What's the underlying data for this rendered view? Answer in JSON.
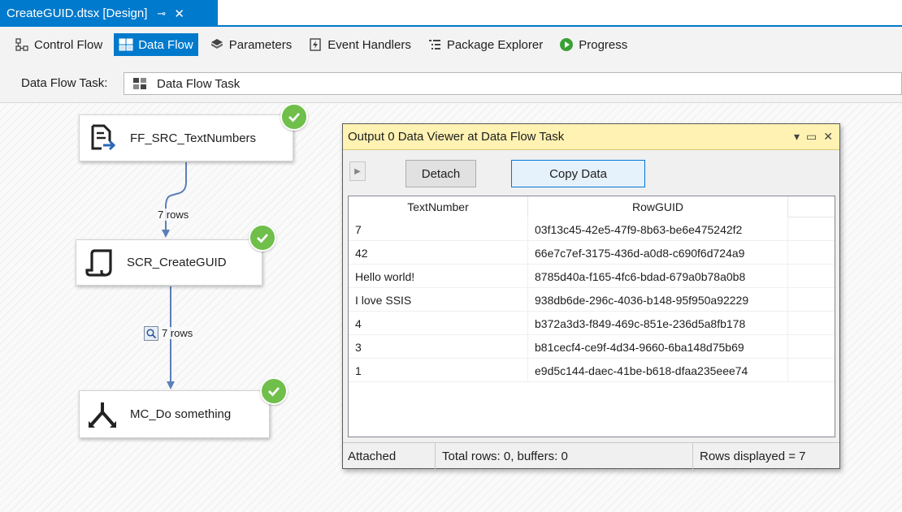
{
  "doc_tab": {
    "title": "CreateGUID.dtsx [Design]",
    "pin_glyph": "⊸",
    "close_glyph": "✕"
  },
  "designer_tabs": [
    {
      "label": "Control Flow",
      "icon": "control-flow-icon",
      "active": false
    },
    {
      "label": "Data Flow",
      "icon": "data-flow-icon",
      "active": true
    },
    {
      "label": "Parameters",
      "icon": "parameters-icon",
      "active": false
    },
    {
      "label": "Event Handlers",
      "icon": "event-handlers-icon",
      "active": false
    },
    {
      "label": "Package Explorer",
      "icon": "package-explorer-icon",
      "active": false
    },
    {
      "label": "Progress",
      "icon": "progress-icon",
      "active": false
    }
  ],
  "task_selector": {
    "label": "Data Flow Task:",
    "value": "Data Flow Task"
  },
  "components": [
    {
      "name": "FF_SRC_TextNumbers",
      "icon": "flat-file-source-icon",
      "status": "success"
    },
    {
      "name": "SCR_CreateGUID",
      "icon": "script-component-icon",
      "status": "success"
    },
    {
      "name": "MC_Do something",
      "icon": "multicast-icon",
      "status": "success"
    }
  ],
  "paths": [
    {
      "label": "7 rows",
      "has_data_viewer": false
    },
    {
      "label": "7 rows",
      "has_data_viewer": true
    }
  ],
  "data_viewer": {
    "title": "Output 0 Data Viewer at Data Flow Task",
    "detach_label": "Detach",
    "copy_label": "Copy Data",
    "columns": [
      "TextNumber",
      "RowGUID"
    ],
    "rows": [
      [
        "7",
        "03f13c45-42e5-47f9-8b63-be6e475242f2"
      ],
      [
        "42",
        "66e7c7ef-3175-436d-a0d8-c690f6d724a9"
      ],
      [
        "Hello world!",
        "8785d40a-f165-4fc6-bdad-679a0b78a0b8"
      ],
      [
        "I love SSIS",
        "938db6de-296c-4036-b148-95f950a92229"
      ],
      [
        "4",
        "b372a3d3-f849-469c-851e-236d5a8fb178"
      ],
      [
        "3",
        "b81cecf4-ce9f-4d34-9660-6ba148d75b69"
      ],
      [
        "1",
        "e9d5c144-daec-41be-b618-dfaa235eee74"
      ]
    ],
    "status": {
      "attached": "Attached",
      "totals": "Total rows: 0, buffers: 0",
      "displayed": "Rows displayed = 7"
    }
  },
  "colors": {
    "accent": "#007acc",
    "success": "#6fbf4a",
    "viewer_title": "#fff2b2",
    "path": "#5b7fb8"
  }
}
